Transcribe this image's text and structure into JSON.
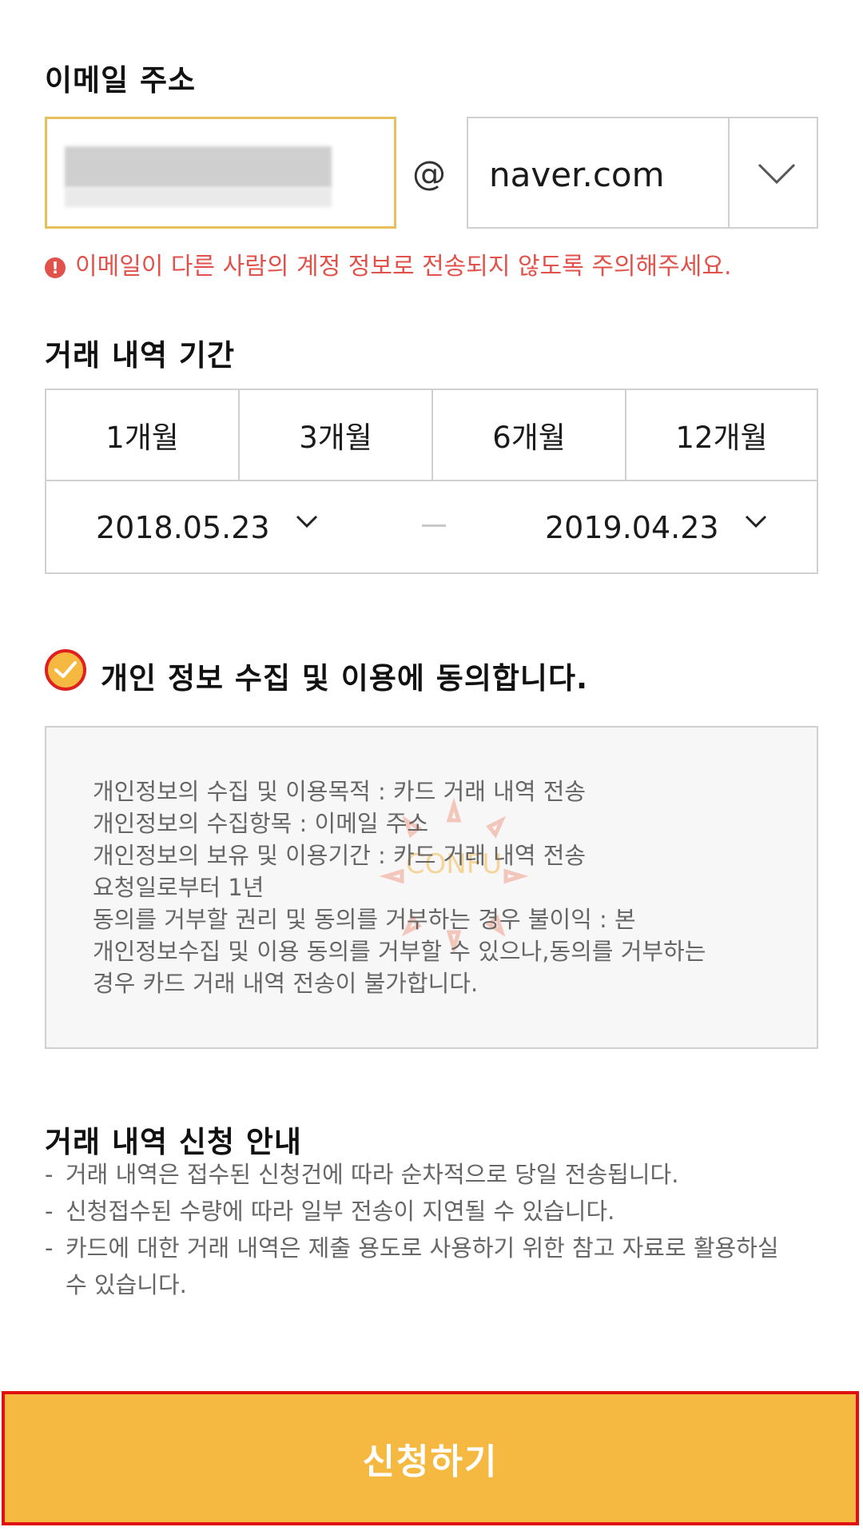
{
  "email": {
    "section_title": "이메일 주소",
    "at_symbol": "@",
    "domain_value": "naver.com",
    "warning_text": "이메일이 다른 사람의 계정 정보로 전송되지 않도록 주의해주세요.",
    "warning_icon": "!"
  },
  "period": {
    "section_title": "거래 내역 기간",
    "options": [
      "1개월",
      "3개월",
      "6개월",
      "12개월"
    ],
    "start_date": "2018.05.23",
    "end_date": "2019.04.23"
  },
  "agreement": {
    "label": "개인 정보 수집 및 이용에 동의합니다.",
    "checked": true,
    "terms_text": "개인정보의 수집 및 이용목적 : 카드 거래 내역 전송\n개인정보의 수집항목 : 이메일 주소\n개인정보의 보유 및 이용기간 : 카드 거래 내역 전송\n요청일로부터 1년\n동의를 거부할 권리 및 동의를 거부하는 경우 불이익 : 본\n개인정보수집 및 이용 동의를 거부할 수 있으나,동의를 거부하는\n경우 카드 거래 내역 전송이 불가합니다.",
    "watermark_text": "CONFU"
  },
  "guide": {
    "title": "거래 내역 신청 안내",
    "items": [
      "거래 내역은 접수된 신청건에 따라 순차적으로 당일 전송됩니다.",
      "신청접수된 수량에 따라 일부 전송이 지연될 수 있습니다.",
      "카드에 대한 거래 내역은 제출 용도로 사용하기 위한 참고 자료로 활용하실 수 있습니다."
    ]
  },
  "submit": {
    "label": "신청하기"
  },
  "colors": {
    "accent": "#f5b941",
    "warning": "#e0524b",
    "border": "#d0d0d0",
    "highlight": "#e01010"
  }
}
